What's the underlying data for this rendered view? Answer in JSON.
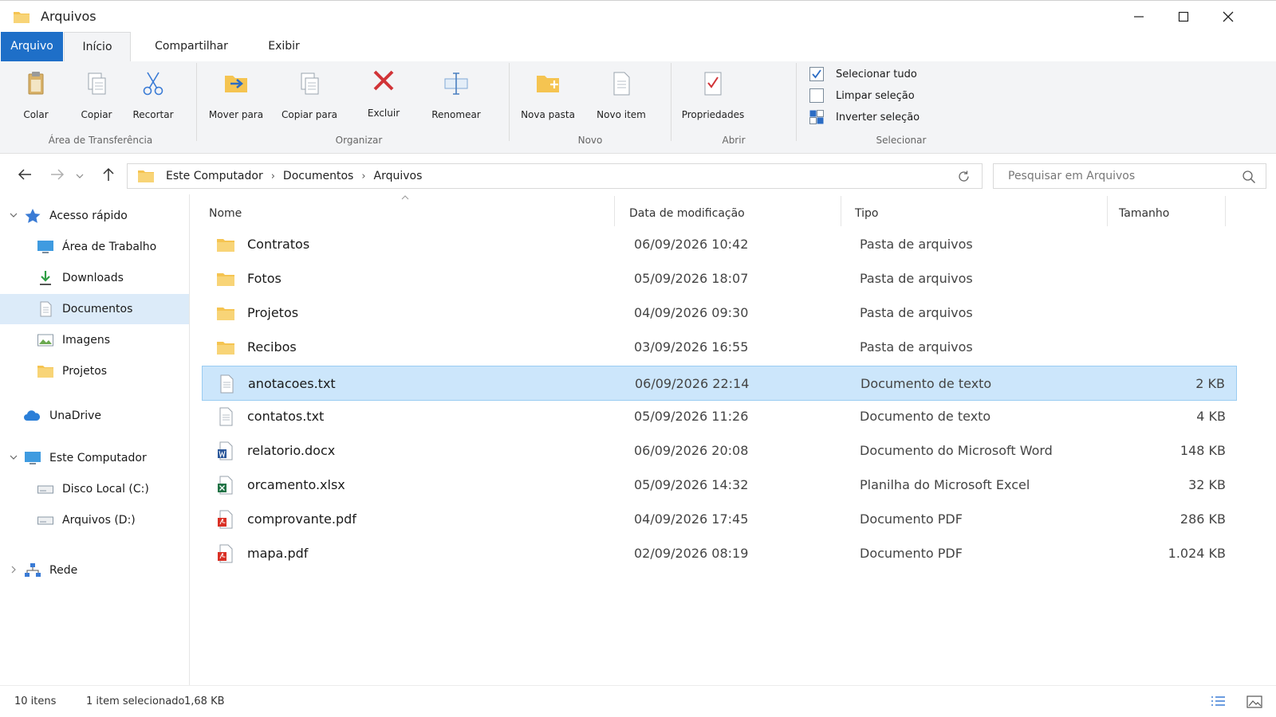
{
  "window": {
    "title": "Arquivos",
    "controls": [
      "minimize-icon",
      "maximize-icon",
      "close-icon"
    ]
  },
  "ribbon": {
    "tabs": [
      {
        "label": "Arquivo",
        "state": "file-menu"
      },
      {
        "label": "Início",
        "state": "active"
      },
      {
        "label": "Compartilhar"
      },
      {
        "label": "Exibir"
      }
    ],
    "clipboard": {
      "group_label": "Área de Transferência",
      "paste": "Colar",
      "copy": "Copiar",
      "cut": "Recortar"
    },
    "organize": {
      "group_label": "Organizar",
      "move_to": "Mover para",
      "copy_to": "Copiar para",
      "delete": "Excluir",
      "rename": "Renomear"
    },
    "new": {
      "group_label": "Novo",
      "new_folder": "Nova pasta",
      "new_item": "Novo item"
    },
    "open": {
      "group_label": "Abrir",
      "properties": "Propriedades"
    },
    "select": {
      "group_label": "Selecionar",
      "select_all": "Selecionar tudo",
      "clear_selection": "Limpar seleção",
      "invert_selection": "Inverter seleção"
    }
  },
  "address": {
    "crumbs": [
      "Este Computador",
      "Documentos",
      "Arquivos"
    ],
    "separator": "›"
  },
  "search": {
    "placeholder": "Pesquisar em Arquivos"
  },
  "sidebar": {
    "quick_access": "Acesso rápido",
    "items": [
      {
        "label": "Área de Trabalho",
        "icon": "desktop-icon"
      },
      {
        "label": "Downloads",
        "icon": "download-icon"
      },
      {
        "label": "Documentos",
        "icon": "document-icon",
        "selected": true
      },
      {
        "label": "Imagens",
        "icon": "image-icon"
      },
      {
        "label": "Projetos",
        "icon": "folder-icon"
      }
    ],
    "cloud": "UnaDrive",
    "computer": "Este Computador",
    "drives": [
      {
        "label": "Disco Local (C:)",
        "icon": "drive-icon"
      },
      {
        "label": "Arquivos (D:)",
        "icon": "drive-icon"
      }
    ],
    "network": "Rede"
  },
  "columns": {
    "name": "Nome",
    "date": "Data de modificação",
    "type": "Tipo",
    "size": "Tamanho"
  },
  "files": [
    {
      "name": "Contratos",
      "date": "06/09/2026  10:42",
      "type": "Pasta de arquivos",
      "size": "",
      "icon": "folder-icon"
    },
    {
      "name": "Fotos",
      "date": "05/09/2026  18:07",
      "type": "Pasta de arquivos",
      "size": "",
      "icon": "folder-icon"
    },
    {
      "name": "Projetos",
      "date": "04/09/2026  09:30",
      "type": "Pasta de arquivos",
      "size": "",
      "icon": "folder-icon"
    },
    {
      "name": "Recibos",
      "date": "03/09/2026  16:55",
      "type": "Pasta de arquivos",
      "size": "",
      "icon": "folder-icon"
    },
    {
      "name": "anotacoes.txt",
      "date": "06/09/2026  22:14",
      "type": "Documento de texto",
      "size": "2 KB",
      "icon": "text-file-icon",
      "selected": true
    },
    {
      "name": "contatos.txt",
      "date": "05/09/2026  11:26",
      "type": "Documento de texto",
      "size": "4 KB",
      "icon": "text-file-icon"
    },
    {
      "name": "relatorio.docx",
      "date": "06/09/2026  20:08",
      "type": "Documento do Microsoft Word",
      "size": "148 KB",
      "icon": "word-file-icon"
    },
    {
      "name": "orcamento.xlsx",
      "date": "05/09/2026  14:32",
      "type": "Planilha do Microsoft Excel",
      "size": "32 KB",
      "icon": "excel-file-icon"
    },
    {
      "name": "comprovante.pdf",
      "date": "04/09/2026  17:45",
      "type": "Documento PDF",
      "size": "286 KB",
      "icon": "pdf-file-icon"
    },
    {
      "name": "mapa.pdf",
      "date": "02/09/2026  08:19",
      "type": "Documento PDF",
      "size": "1.024 KB",
      "icon": "pdf-file-icon"
    }
  ],
  "status": {
    "item_count": "10 itens",
    "selection": "1 item selecionado",
    "selection_size": "1,68 KB"
  },
  "colors": {
    "accent": "#1e6fc8",
    "selection_bg": "#cce6fb",
    "folder": "#f5c451"
  }
}
